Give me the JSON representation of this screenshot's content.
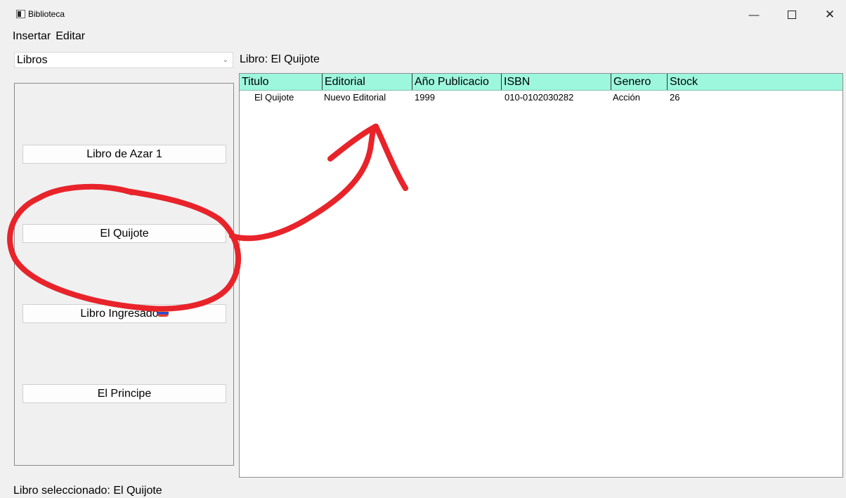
{
  "window": {
    "title": "Biblioteca",
    "minimize_glyph": "—",
    "close_glyph": "✕"
  },
  "menu": [
    "Insertar",
    "Editar"
  ],
  "category_select": {
    "value": "Libros",
    "chevron": "⌄"
  },
  "current_book_label": "Libro: El Quijote",
  "book_buttons": [
    "Libro de Azar 1",
    "El Quijote",
    "Libro Ingresado",
    "El Principe"
  ],
  "table": {
    "headers": [
      "Titulo",
      "Editorial",
      "Año Publicacio",
      "ISBN",
      "Genero",
      "Stock"
    ],
    "rows": [
      [
        "El Quijote",
        "Nuevo Editorial",
        "1999",
        "010-0102030282",
        "Acción",
        "26"
      ]
    ],
    "header_color": "#9cf7dd"
  },
  "status_text": "Libro seleccionado: El Quijote",
  "annotation_color": "#e8232a"
}
